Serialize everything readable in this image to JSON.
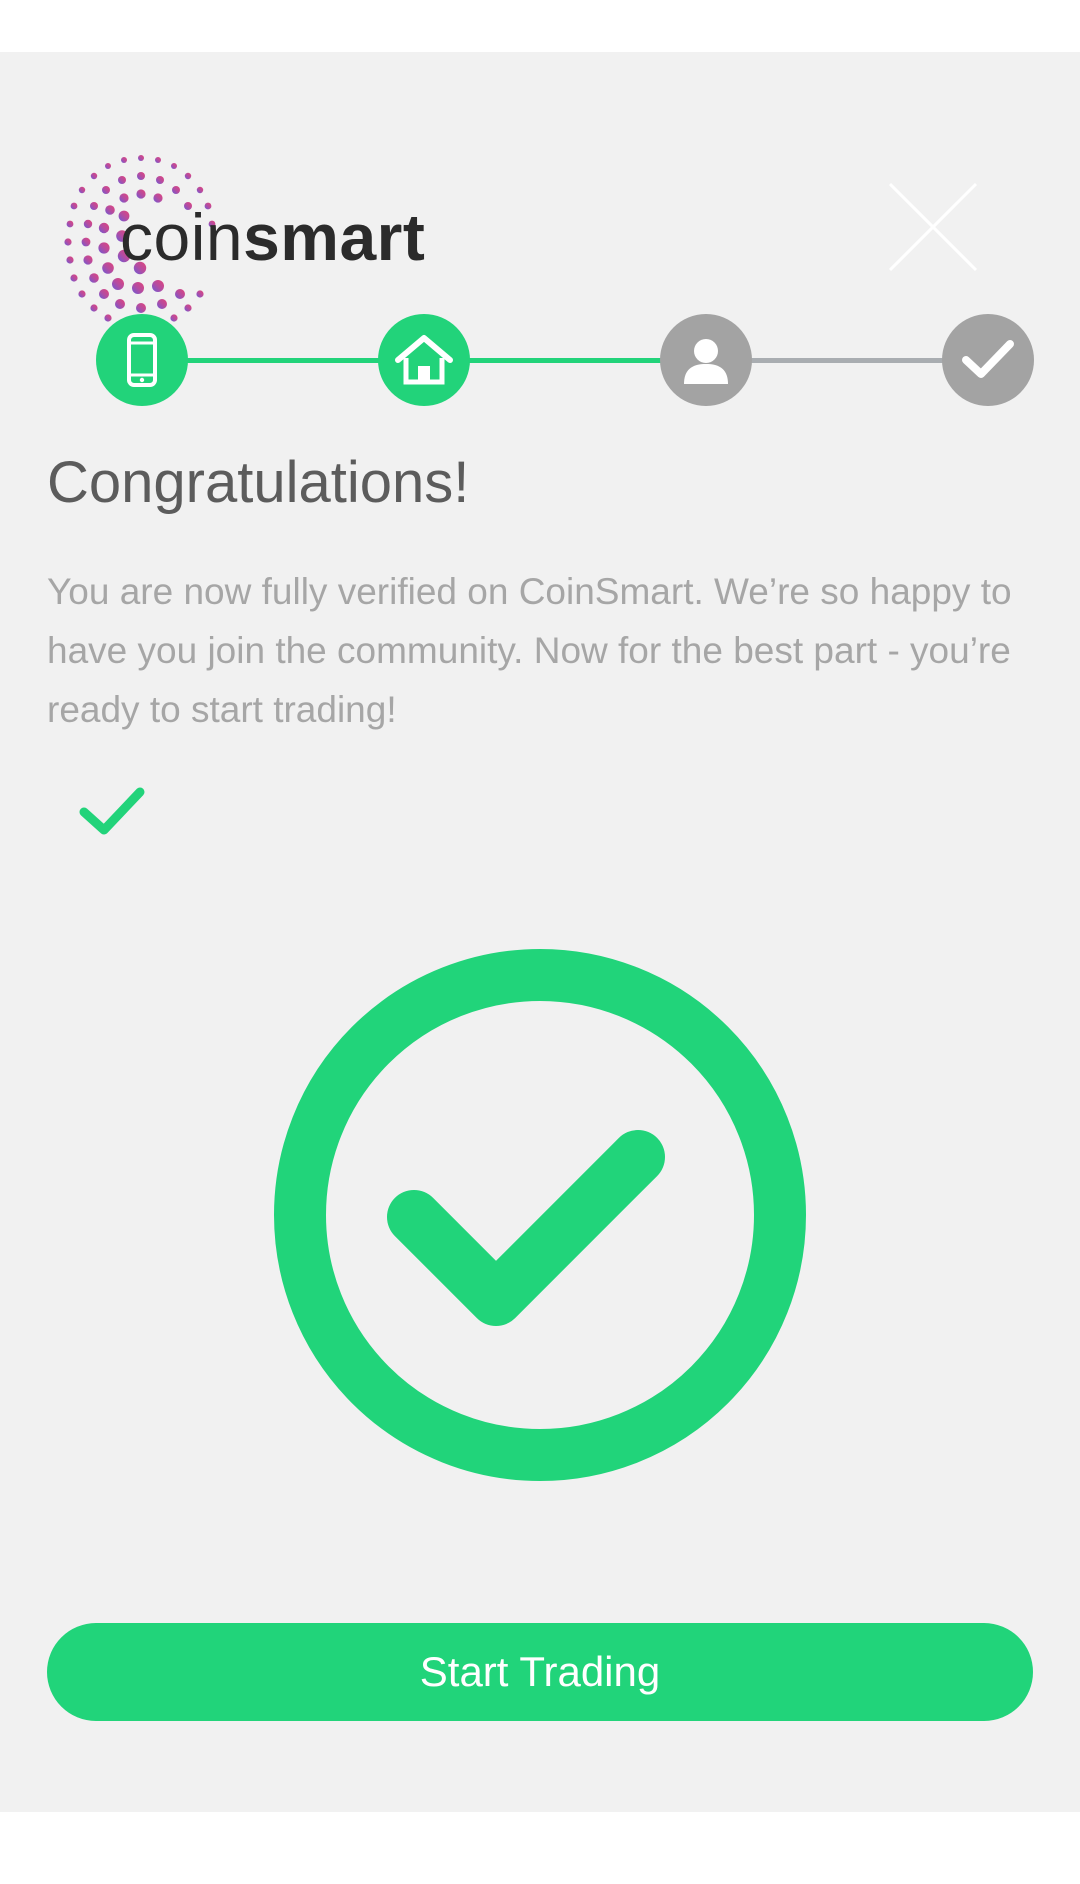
{
  "brand": {
    "name_light": "coin",
    "name_bold": "smart"
  },
  "header": {
    "close_icon": "close-icon"
  },
  "stepper": {
    "steps": [
      {
        "icon": "phone-icon",
        "status": "complete"
      },
      {
        "icon": "home-icon",
        "status": "complete"
      },
      {
        "icon": "user-icon",
        "status": "pending"
      },
      {
        "icon": "check-icon",
        "status": "pending"
      }
    ],
    "colors": {
      "complete": "#22d37a",
      "pending": "#a3a3a3"
    }
  },
  "main": {
    "title": "Congratulations!",
    "message": "You are now fully verified on CoinSmart. We’re so happy to have you join the community. Now for the best part - you’re ready to start trading!",
    "status_icon": "check-circle-icon"
  },
  "cta": {
    "label": "Start Trading"
  },
  "colors": {
    "accent": "#21d47a",
    "background": "#f1f1f1",
    "title_text": "#5c5c5c",
    "body_text": "#a6a6a6"
  }
}
